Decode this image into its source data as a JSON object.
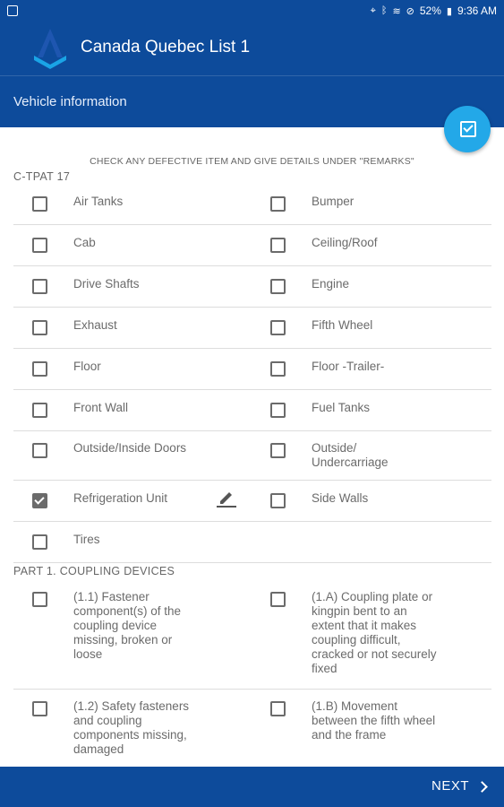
{
  "status_bar": {
    "battery": "52%",
    "time": "9:36 AM",
    "icons": [
      "location-icon",
      "bluetooth-icon",
      "wifi-icon",
      "alarm-icon",
      "battery-icon"
    ]
  },
  "app_bar": {
    "title": "Canada Quebec List 1",
    "logo": "tri-a-logo"
  },
  "sub_bar": {
    "title": "Vehicle information"
  },
  "fab": {
    "icon": "checkbox-icon"
  },
  "instructions": "CHECK ANY DEFECTIVE ITEM AND GIVE DETAILS UNDER \"REMARKS\"",
  "sections": [
    {
      "title": "C-TPAT 17",
      "rows": [
        [
          {
            "label": "Air Tanks",
            "checked": false
          },
          {
            "label": "Bumper",
            "checked": false
          }
        ],
        [
          {
            "label": "Cab",
            "checked": false
          },
          {
            "label": "Ceiling/Roof",
            "checked": false
          }
        ],
        [
          {
            "label": "Drive Shafts",
            "checked": false
          },
          {
            "label": "Engine",
            "checked": false
          }
        ],
        [
          {
            "label": "Exhaust",
            "checked": false
          },
          {
            "label": "Fifth Wheel",
            "checked": false
          }
        ],
        [
          {
            "label": "Floor",
            "checked": false
          },
          {
            "label": "Floor -Trailer-",
            "checked": false
          }
        ],
        [
          {
            "label": "Front Wall",
            "checked": false
          },
          {
            "label": "Fuel Tanks",
            "checked": false
          }
        ],
        [
          {
            "label": "Outside/Inside Doors",
            "checked": false
          },
          {
            "label": "Outside/ Undercarriage",
            "checked": false
          }
        ],
        [
          {
            "label": "Refrigeration Unit",
            "checked": true,
            "has_edit": true
          },
          {
            "label": "Side Walls",
            "checked": false
          }
        ],
        [
          {
            "label": "Tires",
            "checked": false
          }
        ]
      ]
    },
    {
      "title": "PART 1. COUPLING DEVICES",
      "rows": [
        [
          {
            "label": "(1.1) Fastener component(s) of the coupling device missing, broken or loose",
            "checked": false
          },
          {
            "label": "(1.A) Coupling plate or kingpin bent to an extent that it makes coupling difficult, cracked or not securely fixed",
            "checked": false
          }
        ],
        [
          {
            "label": "(1.2) Safety fasteners and coupling components missing, damaged",
            "checked": false
          },
          {
            "label": "(1.B) Movement between the fifth wheel and the frame",
            "checked": false
          }
        ]
      ]
    }
  ],
  "footer": {
    "next_label": "NEXT"
  }
}
